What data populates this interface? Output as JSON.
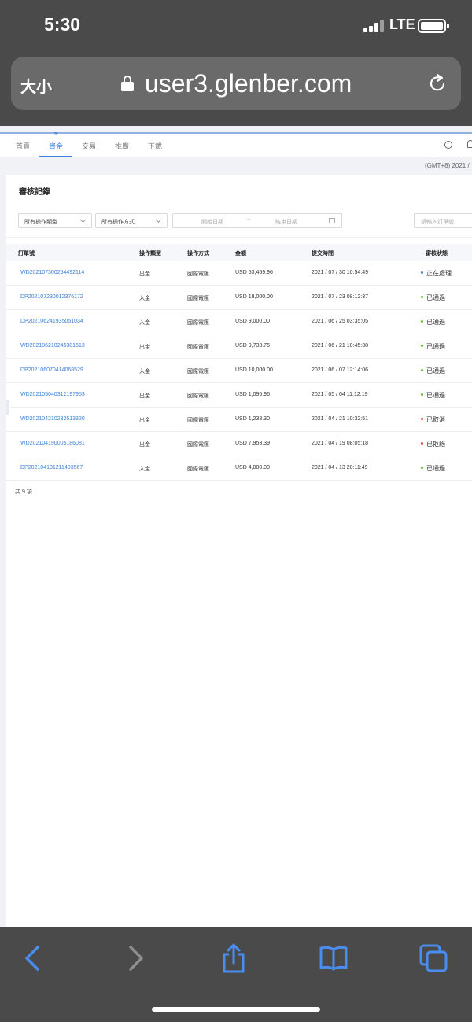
{
  "status_bar": {
    "time": "5:30",
    "network": "LTE"
  },
  "browser": {
    "text_size_label": "大小",
    "url": "user3.glenber.com"
  },
  "nav": {
    "tabs": [
      "首頁",
      "資金",
      "交易",
      "推廣",
      "下載"
    ],
    "active_tab": "資金",
    "timezone": "(GMT+8) 2021 /"
  },
  "section_title": "審核記錄",
  "filters": {
    "operation_type": "所有操作類型",
    "operation_method": "所有操作方式",
    "start_date_placeholder": "開始日期",
    "range_dash": "~",
    "end_date_placeholder": "結束日期",
    "order_search_placeholder": "請輸入訂單號"
  },
  "table": {
    "headers": [
      "訂單號",
      "操作類型",
      "操作方式",
      "金額",
      "提交時間",
      "審核狀態"
    ],
    "rows": [
      {
        "order": "WD202107300254492114",
        "type": "出金",
        "method": "國際電匯",
        "amount": "USD 53,459.96",
        "time": "2021 / 07 / 30 10:54:49",
        "status": "正在處理",
        "status_color": "#3d7fd6"
      },
      {
        "order": "DP202107230012376172",
        "type": "入金",
        "method": "國際電匯",
        "amount": "USD 18,000.00",
        "time": "2021 / 07 / 23 08:12:37",
        "status": "已通過",
        "status_color": "#52c41a"
      },
      {
        "order": "DP202106241935051034",
        "type": "入金",
        "method": "國際電匯",
        "amount": "USD 9,000.00",
        "time": "2021 / 06 / 25 03:35:05",
        "status": "已通過",
        "status_color": "#52c41a"
      },
      {
        "order": "WD202106210245381613",
        "type": "出金",
        "method": "國際電匯",
        "amount": "USD 9,733.75",
        "time": "2021 / 06 / 21 10:45:38",
        "status": "已通過",
        "status_color": "#52c41a"
      },
      {
        "order": "DP202106070414068529",
        "type": "入金",
        "method": "國際電匯",
        "amount": "USD 10,000.00",
        "time": "2021 / 06 / 07 12:14:06",
        "status": "已通過",
        "status_color": "#52c41a"
      },
      {
        "order": "WD202105040312197953",
        "type": "出金",
        "method": "國際電匯",
        "amount": "USD 1,095.96",
        "time": "2021 / 05 / 04 11:12:19",
        "status": "已通過",
        "status_color": "#52c41a"
      },
      {
        "order": "WD202104210232513320",
        "type": "出金",
        "method": "國際電匯",
        "amount": "USD 1,238.30",
        "time": "2021 / 04 / 21 10:32:51",
        "status": "已取消",
        "status_color": "#e0403a"
      },
      {
        "order": "WD202104190005186081",
        "type": "出金",
        "method": "國際電匯",
        "amount": "USD 7,953.39",
        "time": "2021 / 04 / 19 08:05:18",
        "status": "已拒絕",
        "status_color": "#e0403a"
      },
      {
        "order": "DP202104131211493567",
        "type": "入金",
        "method": "國際電匯",
        "amount": "USD 4,000.00",
        "time": "2021 / 04 / 13 20:11:49",
        "status": "已通過",
        "status_color": "#52c41a"
      }
    ],
    "total": "共 9 項"
  },
  "colors": {
    "accent": "#3d7fd6",
    "ios_blue": "#4a8df0",
    "ios_gray": "#8e8e93"
  },
  "toolbar_icons": [
    "back-icon",
    "forward-icon",
    "share-icon",
    "bookmarks-icon",
    "tabs-icon"
  ]
}
